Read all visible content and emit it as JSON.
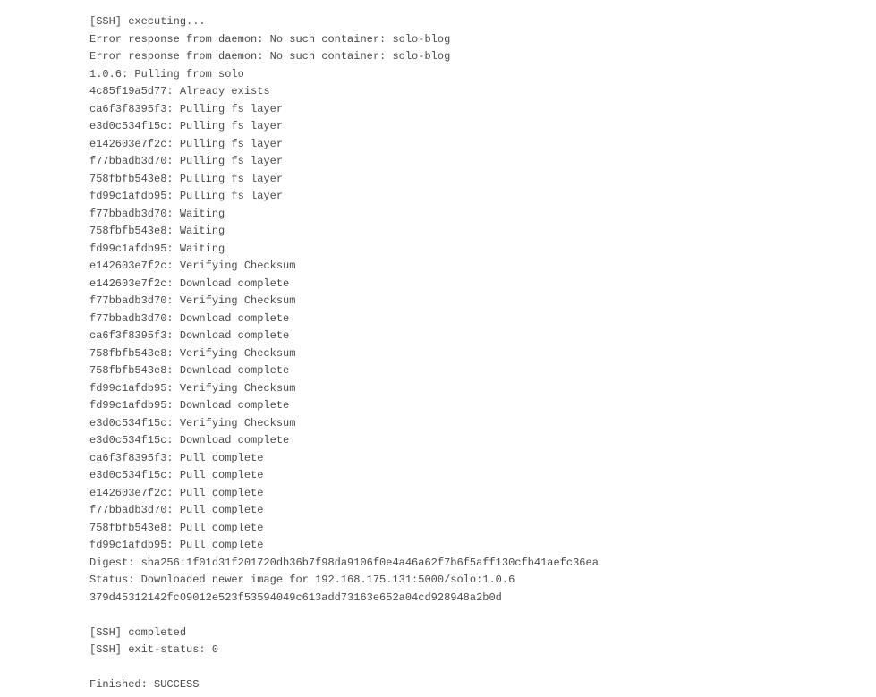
{
  "log": {
    "lines": [
      "[SSH] executing...",
      "Error response from daemon: No such container: solo-blog",
      "Error response from daemon: No such container: solo-blog",
      "1.0.6: Pulling from solo",
      "4c85f19a5d77: Already exists",
      "ca6f3f8395f3: Pulling fs layer",
      "e3d0c534f15c: Pulling fs layer",
      "e142603e7f2c: Pulling fs layer",
      "f77bbadb3d70: Pulling fs layer",
      "758fbfb543e8: Pulling fs layer",
      "fd99c1afdb95: Pulling fs layer",
      "f77bbadb3d70: Waiting",
      "758fbfb543e8: Waiting",
      "fd99c1afdb95: Waiting",
      "e142603e7f2c: Verifying Checksum",
      "e142603e7f2c: Download complete",
      "f77bbadb3d70: Verifying Checksum",
      "f77bbadb3d70: Download complete",
      "ca6f3f8395f3: Download complete",
      "758fbfb543e8: Verifying Checksum",
      "758fbfb543e8: Download complete",
      "fd99c1afdb95: Verifying Checksum",
      "fd99c1afdb95: Download complete",
      "e3d0c534f15c: Verifying Checksum",
      "e3d0c534f15c: Download complete",
      "ca6f3f8395f3: Pull complete",
      "e3d0c534f15c: Pull complete",
      "e142603e7f2c: Pull complete",
      "f77bbadb3d70: Pull complete",
      "758fbfb543e8: Pull complete",
      "fd99c1afdb95: Pull complete",
      "Digest: sha256:1f01d31f201720db36b7f98da9106f0e4a46a62f7b6f5aff130cfb41aefc36ea",
      "Status: Downloaded newer image for 192.168.175.131:5000/solo:1.0.6",
      "379d45312142fc09012e523f53594049c613add73163e652a04cd928948a2b0d",
      "",
      "[SSH] completed",
      "[SSH] exit-status: 0",
      "",
      "Finished: SUCCESS"
    ]
  }
}
